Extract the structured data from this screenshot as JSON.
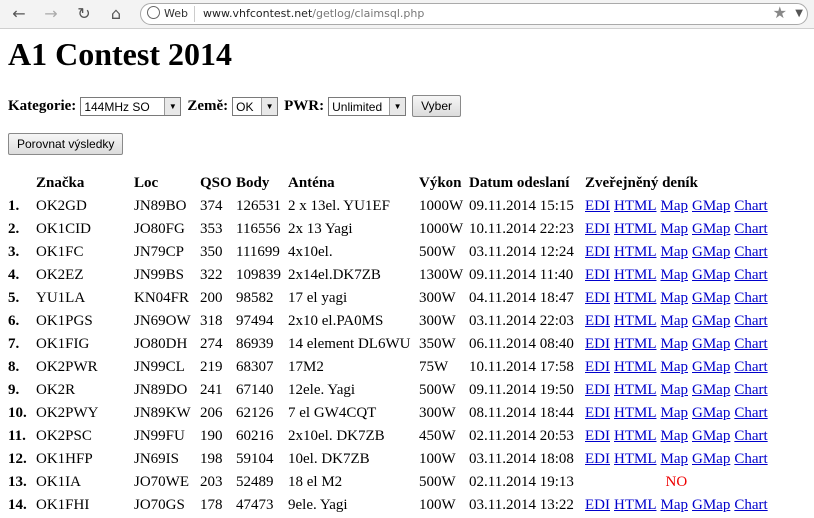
{
  "browser": {
    "back_icon": "back-arrow-icon",
    "forward_icon": "forward-arrow-icon",
    "reload_icon": "reload-icon",
    "home_icon": "home-icon",
    "chip_label": "Web",
    "url_host": "www.vhfcontest.net",
    "url_path": "/getlog/claimsql.php"
  },
  "page": {
    "title": "A1 Contest 2014"
  },
  "filters": {
    "category_label": "Kategorie:",
    "category_value": "144MHz SO",
    "country_label": "Země:",
    "country_value": "OK",
    "power_label": "PWR:",
    "power_value": "Unlimited",
    "select_button": "Vyber",
    "compare_button": "Porovnat výsledky"
  },
  "table": {
    "headers": [
      "Značka",
      "Loc",
      "QSO",
      "Body",
      "Anténa",
      "Výkon",
      "Datum odeslaní",
      "Zveřejněný deník"
    ],
    "link_labels": [
      "EDI",
      "HTML",
      "Map",
      "GMap",
      "Chart"
    ],
    "not_published": "NO",
    "rows": [
      {
        "rank": "1.",
        "call": "OK2GD",
        "loc": "JN89BO",
        "qso": "374",
        "body": "126531",
        "ant": "2 x 13el. YU1EF",
        "pwr": "1000W",
        "date": "09.11.2014 15:15",
        "published": true
      },
      {
        "rank": "2.",
        "call": "OK1CID",
        "loc": "JO80FG",
        "qso": "353",
        "body": "116556",
        "ant": "2x 13 Yagi",
        "pwr": "1000W",
        "date": "10.11.2014 22:23",
        "published": true
      },
      {
        "rank": "3.",
        "call": "OK1FC",
        "loc": "JN79CP",
        "qso": "350",
        "body": "111699",
        "ant": "4x10el.",
        "pwr": "500W",
        "date": "03.11.2014 12:24",
        "published": true
      },
      {
        "rank": "4.",
        "call": "OK2EZ",
        "loc": "JN99BS",
        "qso": "322",
        "body": "109839",
        "ant": "2x14el.DK7ZB",
        "pwr": "1300W",
        "date": "09.11.2014 11:40",
        "published": true
      },
      {
        "rank": "5.",
        "call": "YU1LA",
        "loc": "KN04FR",
        "qso": "200",
        "body": "98582",
        "ant": "17 el yagi",
        "pwr": "300W",
        "date": "04.11.2014 18:47",
        "published": true
      },
      {
        "rank": "6.",
        "call": "OK1PGS",
        "loc": "JN69OW",
        "qso": "318",
        "body": "97494",
        "ant": "2x10 el.PA0MS",
        "pwr": "300W",
        "date": "03.11.2014 22:03",
        "published": true
      },
      {
        "rank": "7.",
        "call": "OK1FIG",
        "loc": "JO80DH",
        "qso": "274",
        "body": "86939",
        "ant": "14 element DL6WU",
        "pwr": "350W",
        "date": "06.11.2014 08:40",
        "published": true
      },
      {
        "rank": "8.",
        "call": "OK2PWR",
        "loc": "JN99CL",
        "qso": "219",
        "body": "68307",
        "ant": "17M2",
        "pwr": "75W",
        "date": "10.11.2014 17:58",
        "published": true
      },
      {
        "rank": "9.",
        "call": "OK2R",
        "loc": "JN89DO",
        "qso": "241",
        "body": "67140",
        "ant": "12ele. Yagi",
        "pwr": "500W",
        "date": "09.11.2014 19:50",
        "published": true
      },
      {
        "rank": "10.",
        "call": "OK2PWY",
        "loc": "JN89KW",
        "qso": "206",
        "body": "62126",
        "ant": "7 el GW4CQT",
        "pwr": "300W",
        "date": "08.11.2014 18:44",
        "published": true
      },
      {
        "rank": "11.",
        "call": "OK2PSC",
        "loc": "JN99FU",
        "qso": "190",
        "body": "60216",
        "ant": "2x10el. DK7ZB",
        "pwr": "450W",
        "date": "02.11.2014 20:53",
        "published": true
      },
      {
        "rank": "12.",
        "call": "OK1HFP",
        "loc": "JN69IS",
        "qso": "198",
        "body": "59104",
        "ant": "10el. DK7ZB",
        "pwr": "100W",
        "date": "03.11.2014 18:08",
        "published": true
      },
      {
        "rank": "13.",
        "call": "OK1IA",
        "loc": "JO70WE",
        "qso": "203",
        "body": "52489",
        "ant": "18 el M2",
        "pwr": "500W",
        "date": "02.11.2014 19:13",
        "published": false
      },
      {
        "rank": "14.",
        "call": "OK1FHI",
        "loc": "JO70GS",
        "qso": "178",
        "body": "47473",
        "ant": "9ele. Yagi",
        "pwr": "100W",
        "date": "03.11.2014 13:22",
        "published": true
      }
    ]
  }
}
